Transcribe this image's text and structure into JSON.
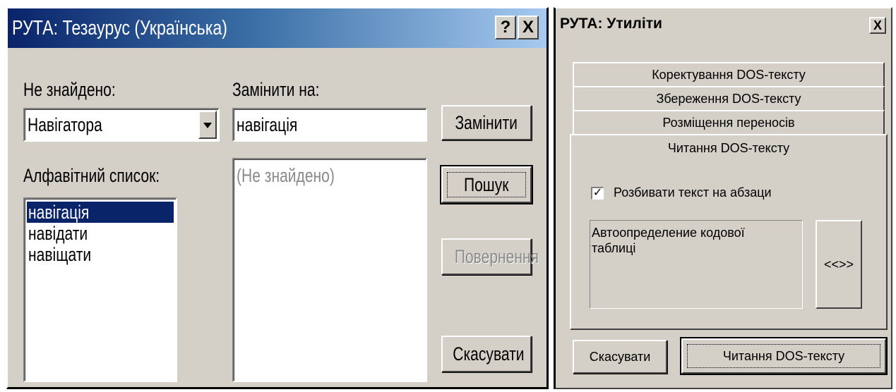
{
  "thesaurus": {
    "title": "РУТА: Тезаурус (Українська)",
    "help_label": "?",
    "close_label": "X",
    "not_found_label": "Не знайдено:",
    "not_found_value": "Навігатора",
    "replace_with_label": "Замінити на:",
    "replace_with_value": "навігація",
    "alphabet_label": "Алфавітний список:",
    "alphabet_items": [
      "навігація",
      "навідати",
      "навіщати"
    ],
    "meanings_placeholder": "(Не знайдено)",
    "buttons": {
      "replace": "Замінити",
      "search": "Пошук",
      "return": "Повернення",
      "cancel": "Скасувати"
    }
  },
  "utilities": {
    "title": "РУТА: Утиліти",
    "close_label": "X",
    "tabs": [
      "Коректування DOS-тексту",
      "Збереження DOS-тексту",
      "Розміщення переносів",
      "Читання DOS-тексту"
    ],
    "checkbox_label": "Розбивати текст на абзаци",
    "checkbox_checked": true,
    "check_mark": "✓",
    "encoding_text": "Автоопределение кодової таблиці",
    "encoding_button": "<<>>",
    "buttons": {
      "cancel": "Скасувати",
      "read": "Читання DOS-тексту"
    }
  },
  "colors": {
    "dialog_bg": "#d4d0c8",
    "title_active_start": "#0a246a",
    "title_active_end": "#a6caf0",
    "selection": "#0a246a"
  }
}
